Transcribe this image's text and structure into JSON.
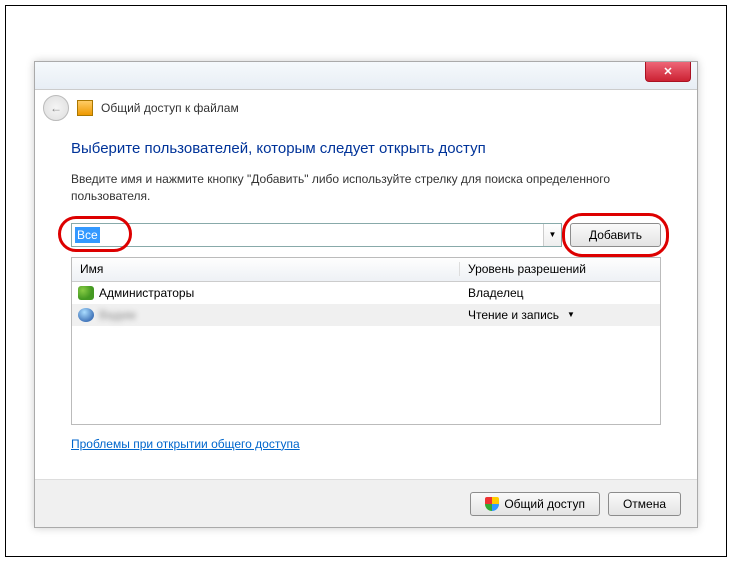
{
  "header": {
    "title": "Общий доступ к файлам"
  },
  "main": {
    "heading": "Выберите пользователей, которым следует открыть доступ",
    "instruction": "Введите имя и нажмите кнопку \"Добавить\" либо используйте стрелку для поиска определенного пользователя.",
    "combo_value": "Все",
    "add_button": "Добавить"
  },
  "table": {
    "col_name": "Имя",
    "col_perm": "Уровень разрешений",
    "rows": [
      {
        "name": "Администраторы",
        "perm": "Владелец",
        "dropdown": false
      },
      {
        "name": "Вадим",
        "perm": "Чтение и запись",
        "dropdown": true
      }
    ]
  },
  "help_link": "Проблемы при открытии общего доступа",
  "footer": {
    "share_button": "Общий доступ",
    "cancel_button": "Отмена"
  }
}
